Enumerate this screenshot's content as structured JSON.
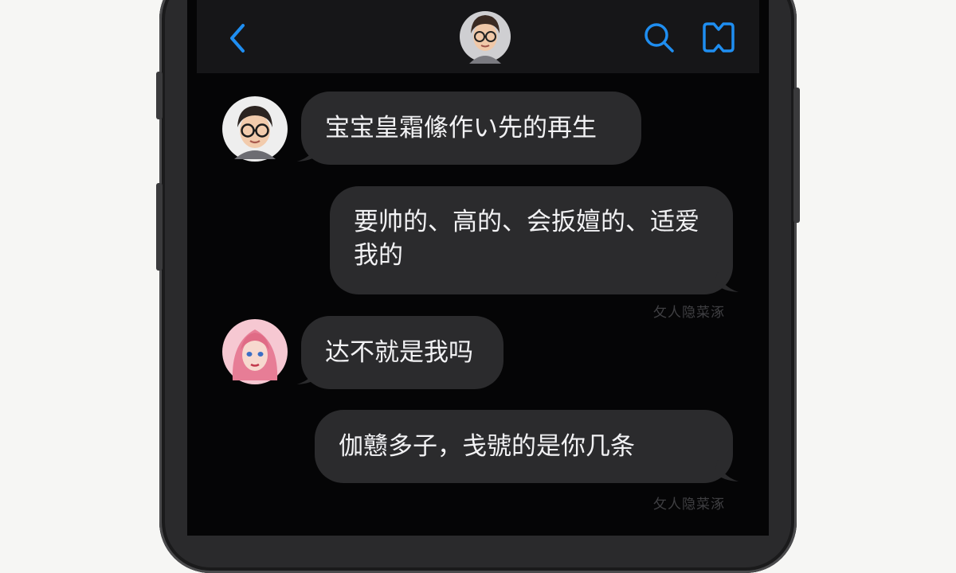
{
  "chat": {
    "messages": [
      {
        "sender": "boy",
        "text": "宝宝皇霜絛作い先的再生"
      },
      {
        "sender": "me",
        "text": "要帅的、高的、会扳嬗的、适爱我的"
      },
      {
        "sender": "girl",
        "text": "达不就是我吗"
      },
      {
        "sender": "me",
        "text": "伽戆多子，戋號的是你几条"
      }
    ],
    "watermark": "攵人隐菜涿",
    "watermark_2": "攵人隐菜涿"
  },
  "colors": {
    "accent": "#1f8ef1",
    "bubble": "#2b2b2d",
    "screen": "#050506",
    "navbar": "#161618"
  },
  "icons": {
    "back": "chevron-left-icon",
    "search": "search-icon",
    "call": "book-call-icon"
  }
}
